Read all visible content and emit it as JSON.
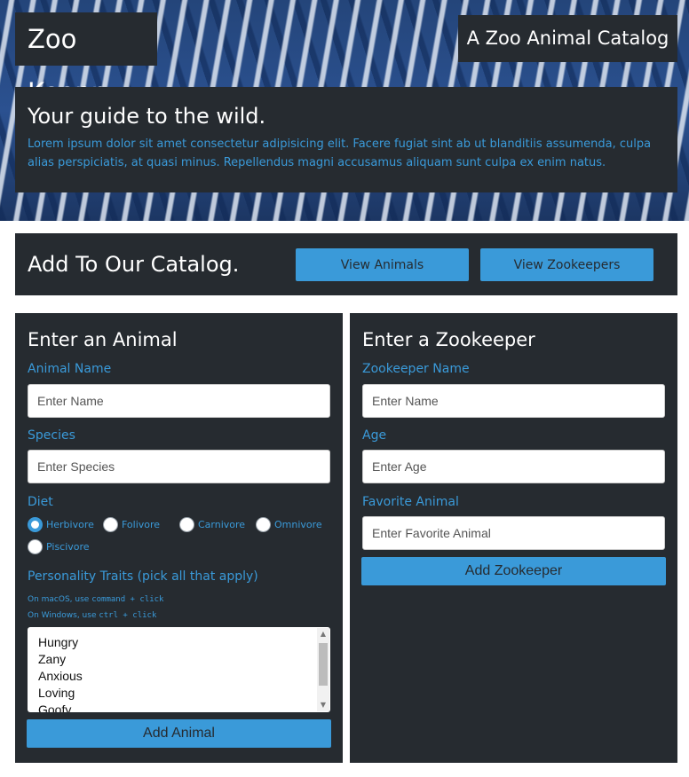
{
  "header": {
    "brand": "Zoo Keepr",
    "tagline": "A Zoo Animal Catalog",
    "intro_title": "Your guide to the wild.",
    "intro_text": "Lorem ipsum dolor sit amet consectetur adipisicing elit. Facere fugiat sint ab ut blanditiis assumenda, culpa alias perspiciatis, at quasi minus. Repellendus magni accusamus aliquam sunt culpa ex enim natus."
  },
  "action_bar": {
    "title": "Add To Our Catalog.",
    "view_animals": "View Animals",
    "view_zookeepers": "View Zookeepers"
  },
  "animal_form": {
    "title": "Enter an Animal",
    "name_label": "Animal Name",
    "name_placeholder": "Enter Name",
    "species_label": "Species",
    "species_placeholder": "Enter Species",
    "diet_label": "Diet",
    "diet_options": [
      "Herbivore",
      "Folivore",
      "Carnivore",
      "Omnivore",
      "Piscivore"
    ],
    "diet_selected": "Herbivore",
    "traits_label": "Personality Traits (pick all that apply)",
    "hint_mac_prefix": "On macOS, use ",
    "hint_mac_code": "command + click",
    "hint_win_prefix": "On Windows, use ",
    "hint_win_code": "ctrl + click",
    "traits": [
      "Hungry",
      "Zany",
      "Anxious",
      "Loving",
      "Goofy"
    ],
    "submit": "Add Animal"
  },
  "zookeeper_form": {
    "title": "Enter a Zookeeper",
    "name_label": "Zookeeper Name",
    "name_placeholder": "Enter Name",
    "age_label": "Age",
    "age_placeholder": "Enter Age",
    "favorite_label": "Favorite Animal",
    "favorite_placeholder": "Enter Favorite Animal",
    "submit": "Add Zookeeper"
  },
  "colors": {
    "panel": "#262b30",
    "accent": "#3a9ad9",
    "hero": "#1f3c6e"
  }
}
